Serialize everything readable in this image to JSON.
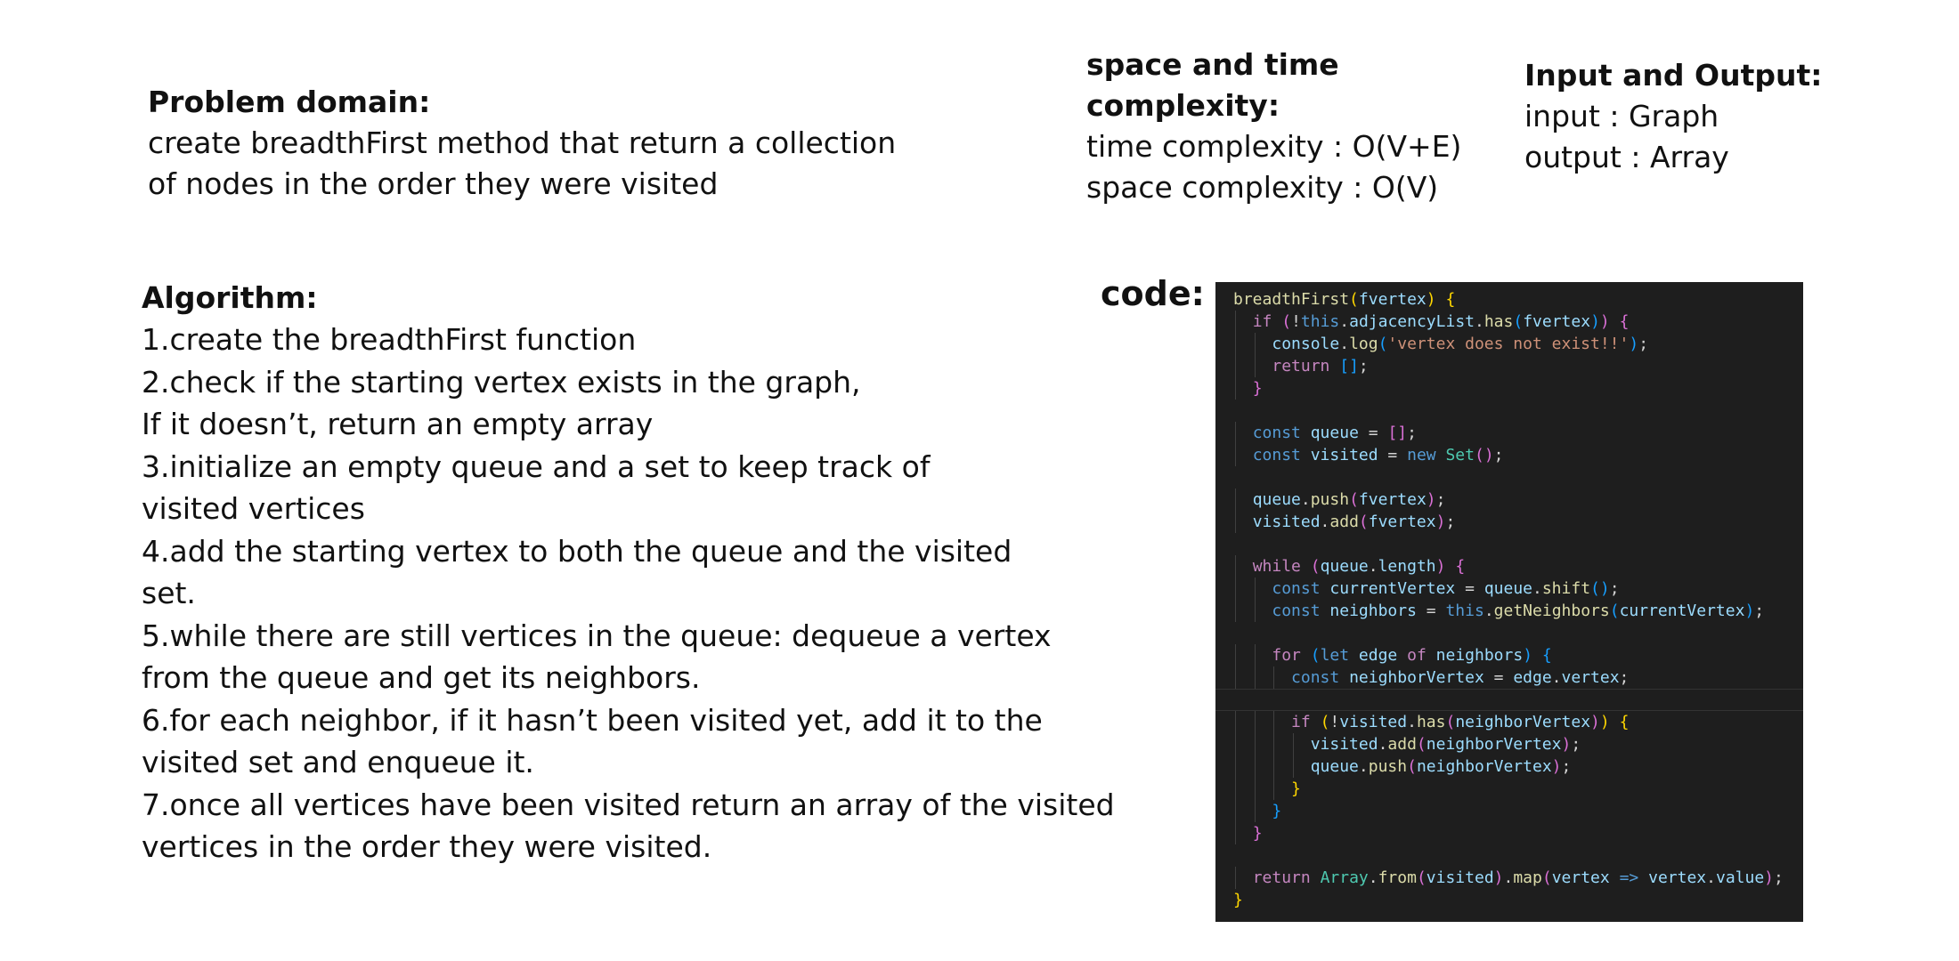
{
  "problem": {
    "heading": "Problem domain:",
    "lines": [
      "create breadthFirst method that return a collection",
      "of nodes in the order they were visited"
    ]
  },
  "complexity": {
    "heading_lines": [
      "space and time",
      "complexity:"
    ],
    "time": "time complexity : O(V+E)",
    "space": "space complexity : O(V)"
  },
  "io": {
    "heading": "Input and Output:",
    "input": "input : Graph",
    "output": "output : Array"
  },
  "algorithm": {
    "heading": "Algorithm:",
    "lines": [
      "1.create the breadthFirst function",
      "2.check if the starting vertex exists in the graph,",
      "If it doesn’t, return an empty array",
      "3.initialize an empty queue and a set to keep track of",
      "visited vertices",
      "4.add the starting vertex to both the queue and the visited",
      "set.",
      "5.while there are still vertices in the queue: dequeue a vertex",
      "from the queue and get its neighbors.",
      "6.for each neighbor, if it hasn’t been visited yet, add it to the",
      "visited set and enqueue it.",
      "7.once all vertices have been visited return an array of the visited",
      "vertices in the order they were visited."
    ]
  },
  "code": {
    "label": "code:",
    "lines": [
      "breadthFirst(fvertex) {",
      "  if (!this.adjacencyList.has(fvertex)) {",
      "    console.log('vertex does not exist!!');",
      "    return [];",
      "  }",
      "",
      "  const queue = [];",
      "  const visited = new Set();",
      "",
      "  queue.push(fvertex);",
      "  visited.add(fvertex);",
      "",
      "  while (queue.length) {",
      "    const currentVertex = queue.shift();",
      "    const neighbors = this.getNeighbors(currentVertex);",
      "",
      "    for (let edge of neighbors) {",
      "      const neighborVertex = edge.vertex;",
      "",
      "      if (!visited.has(neighborVertex)) {",
      "        visited.add(neighborVertex);",
      "        queue.push(neighborVertex);",
      "      }",
      "    }",
      "  }",
      "",
      "  return Array.from(visited).map(vertex => vertex.value);",
      "}"
    ]
  }
}
